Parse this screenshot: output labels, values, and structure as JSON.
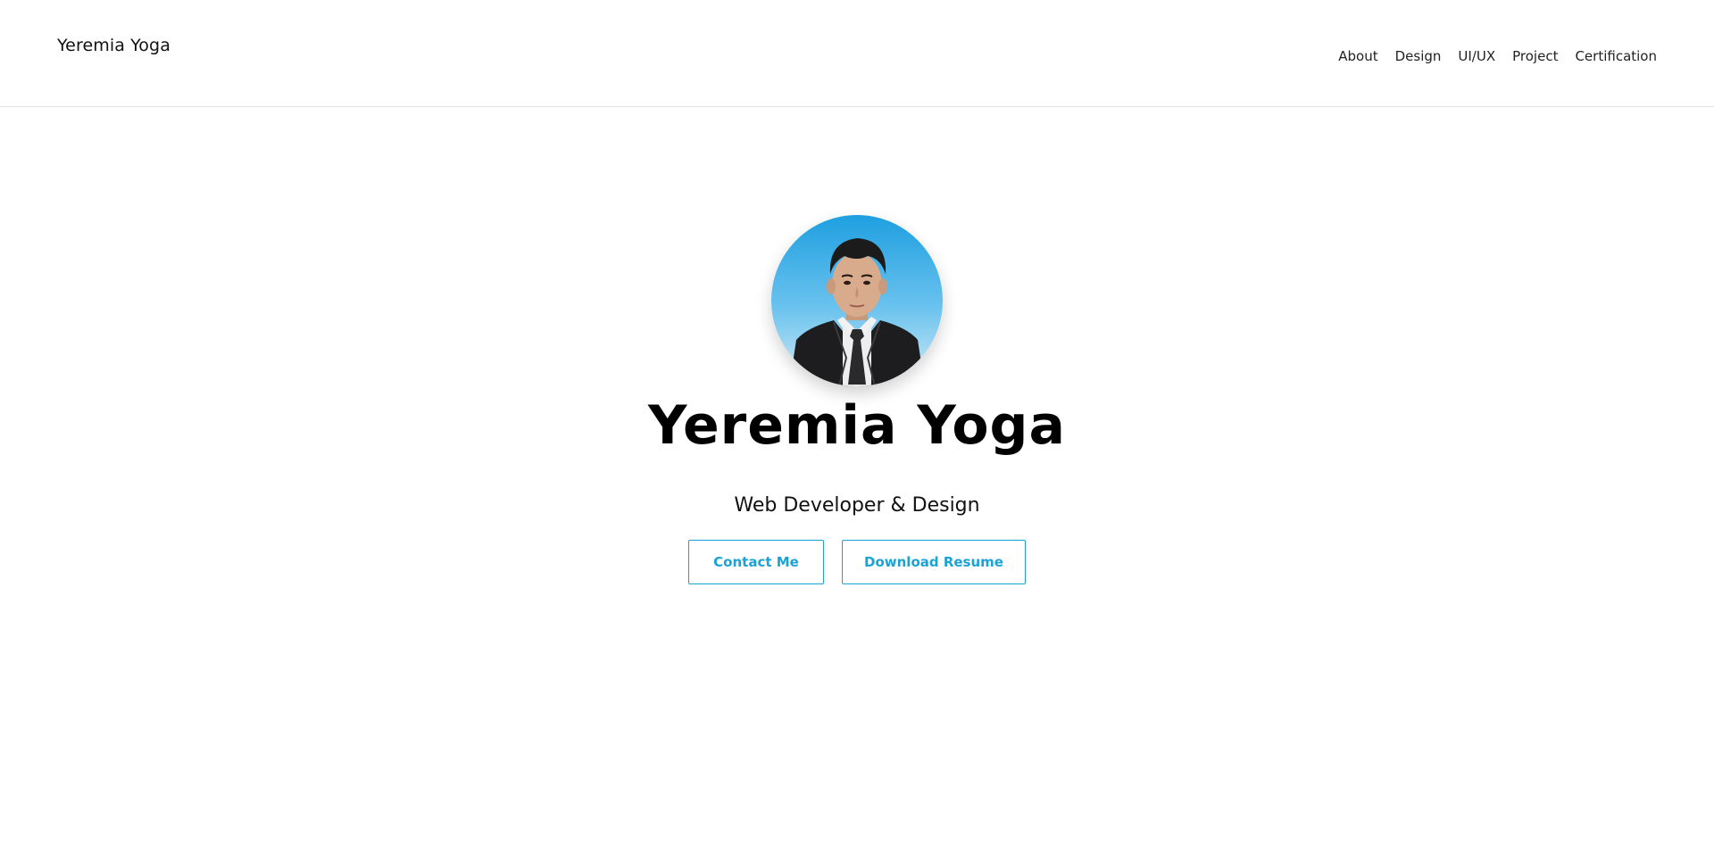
{
  "header": {
    "brand": "Yeremia Yoga",
    "nav": [
      {
        "label": "About"
      },
      {
        "label": "Design"
      },
      {
        "label": "UI/UX"
      },
      {
        "label": "Project"
      },
      {
        "label": "Certification"
      }
    ]
  },
  "hero": {
    "name": "Yeremia Yoga",
    "tagline": "Web Developer & Design",
    "buttons": {
      "contact": "Contact Me",
      "resume": "Download Resume"
    }
  },
  "colors": {
    "accent": "#1aa3d6",
    "avatar_bg_top": "#1e9fe0",
    "avatar_bg_bottom": "#cfe9f6"
  }
}
